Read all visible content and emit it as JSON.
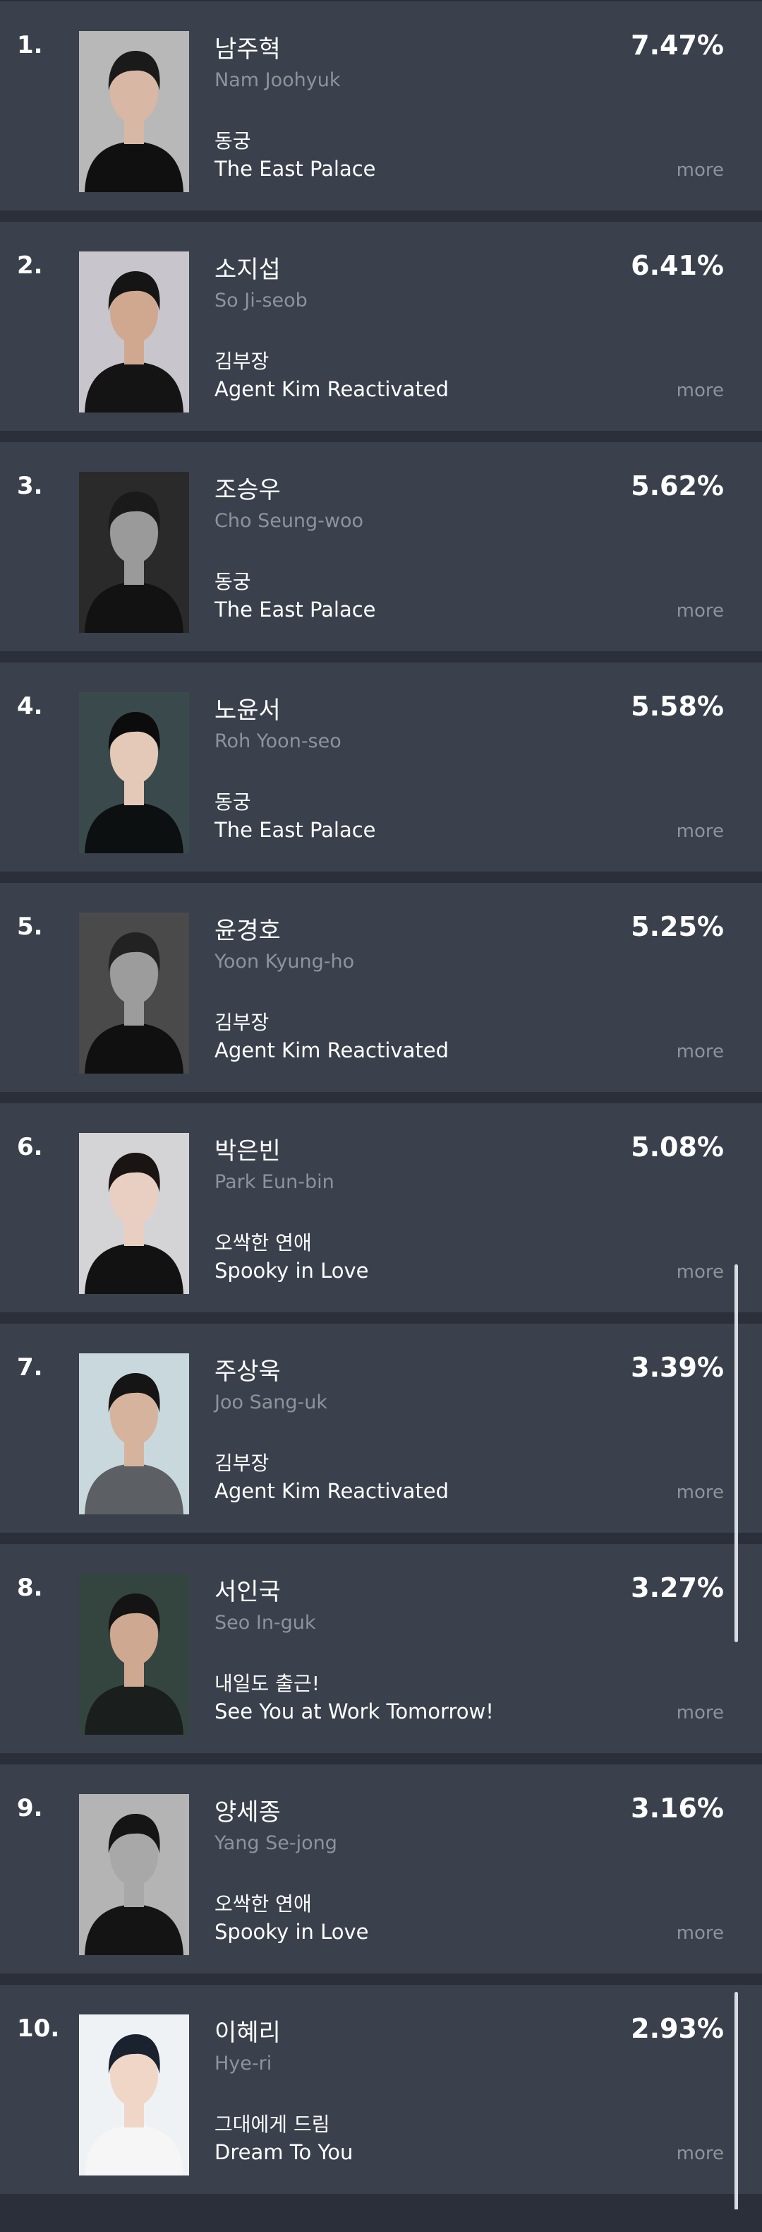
{
  "rankings": [
    {
      "rank": "1.",
      "name_ko": "남주혁",
      "name_en": "Nam Joohyuk",
      "drama_ko": "동궁",
      "drama_en": "The East Palace",
      "percent": "7.47%",
      "more": "more",
      "photo_bg": "#b8b8b8",
      "photo_shirt": "#101010",
      "photo_hair": "#1a1a1a",
      "photo_skin": "#d8b8a4"
    },
    {
      "rank": "2.",
      "name_ko": "소지섭",
      "name_en": "So Ji-seob",
      "drama_ko": "김부장",
      "drama_en": "Agent Kim Reactivated",
      "percent": "6.41%",
      "more": "more",
      "photo_bg": "#c8c6cc",
      "photo_shirt": "#141414",
      "photo_hair": "#151515",
      "photo_skin": "#cfa88f"
    },
    {
      "rank": "3.",
      "name_ko": "조승우",
      "name_en": "Cho Seung-woo",
      "drama_ko": "동궁",
      "drama_en": "The East Palace",
      "percent": "5.62%",
      "more": "more",
      "photo_bg": "#2a2a2a",
      "photo_shirt": "#121212",
      "photo_hair": "#1a1a1a",
      "photo_skin": "#9a9a9a"
    },
    {
      "rank": "4.",
      "name_ko": "노윤서",
      "name_en": "Roh Yoon-seo",
      "drama_ko": "동궁",
      "drama_en": "The East Palace",
      "percent": "5.58%",
      "more": "more",
      "photo_bg": "#3a4a4c",
      "photo_shirt": "#0d1010",
      "photo_hair": "#0c0c0c",
      "photo_skin": "#e4c9b8"
    },
    {
      "rank": "5.",
      "name_ko": "윤경호",
      "name_en": "Yoon Kyung-ho",
      "drama_ko": "김부장",
      "drama_en": "Agent Kim Reactivated",
      "percent": "5.25%",
      "more": "more",
      "photo_bg": "#4a4a4a",
      "photo_shirt": "#101010",
      "photo_hair": "#222222",
      "photo_skin": "#9c9c9c"
    },
    {
      "rank": "6.",
      "name_ko": "박은빈",
      "name_en": "Park Eun-bin",
      "drama_ko": "오싹한 연애",
      "drama_en": "Spooky in Love",
      "percent": "5.08%",
      "more": "more",
      "photo_bg": "#d4d4d6",
      "photo_shirt": "#121212",
      "photo_hair": "#1a1412",
      "photo_skin": "#e8cfc2"
    },
    {
      "rank": "7.",
      "name_ko": "주상욱",
      "name_en": "Joo Sang-uk",
      "drama_ko": "김부장",
      "drama_en": "Agent Kim Reactivated",
      "percent": "3.39%",
      "more": "more",
      "photo_bg": "#c9d8dc",
      "photo_shirt": "#5c5f63",
      "photo_hair": "#151515",
      "photo_skin": "#d6b39c"
    },
    {
      "rank": "8.",
      "name_ko": "서인국",
      "name_en": "Seo In-guk",
      "drama_ko": "내일도 출근!",
      "drama_en": "See You at Work Tomorrow!",
      "percent": "3.27%",
      "more": "more",
      "photo_bg": "#344540",
      "photo_shirt": "#1a1f1e",
      "photo_hair": "#141414",
      "photo_skin": "#cfa891"
    },
    {
      "rank": "9.",
      "name_ko": "양세종",
      "name_en": "Yang Se-jong",
      "drama_ko": "오싹한 연애",
      "drama_en": "Spooky in Love",
      "percent": "3.16%",
      "more": "more",
      "photo_bg": "#b4b4b4",
      "photo_shirt": "#141414",
      "photo_hair": "#151515",
      "photo_skin": "#a8a8a8"
    },
    {
      "rank": "10.",
      "name_ko": "이혜리",
      "name_en": "Hye-ri",
      "drama_ko": "그대에게 드림",
      "drama_en": "Dream To You",
      "percent": "2.93%",
      "more": "more",
      "photo_bg": "#eef2f4",
      "photo_shirt": "#f6f6f6",
      "photo_hair": "#1a2230",
      "photo_skin": "#f0d6c6"
    }
  ],
  "colors": {
    "page_background": "#2a2f3a",
    "card_background": "#3a404c",
    "primary_text": "#ffffff",
    "secondary_text": "#8e939c",
    "scrollbar": "#d9dbe0"
  }
}
